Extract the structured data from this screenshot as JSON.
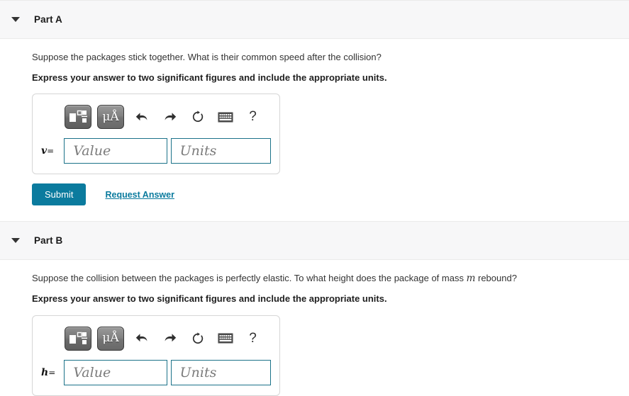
{
  "parts": [
    {
      "id": "part-a",
      "title": "Part A",
      "caret_icon": "chevron-down-icon",
      "question": "Suppose the packages stick together. What is their common speed after the collision?",
      "instruction": "Express your answer to two significant figures and include the appropriate units.",
      "variable": "v",
      "equals": "=",
      "value_placeholder": "Value",
      "units_placeholder": "Units",
      "value_text": "",
      "units_text": "",
      "toolbar": {
        "template_button": "template-icon",
        "units_button_label": "μÅ",
        "undo_icon": "undo-arrow-icon",
        "redo_icon": "redo-arrow-icon",
        "reset_icon": "reset-circular-arrow-icon",
        "keyboard_icon": "keyboard-icon",
        "help_icon": "?"
      },
      "submit_label": "Submit",
      "request_answer_label": "Request Answer",
      "has_actions": true
    },
    {
      "id": "part-b",
      "title": "Part B",
      "caret_icon": "chevron-down-icon",
      "question_prefix": "Suppose the collision between the packages is perfectly elastic. To what height does the package of mass ",
      "question_math": "m",
      "question_suffix": " rebound?",
      "instruction": "Express your answer to two significant figures and include the appropriate units.",
      "variable": "h",
      "equals": "=",
      "value_placeholder": "Value",
      "units_placeholder": "Units",
      "value_text": "",
      "units_text": "",
      "toolbar": {
        "template_button": "template-icon",
        "units_button_label": "μÅ",
        "undo_icon": "undo-arrow-icon",
        "redo_icon": "redo-arrow-icon",
        "reset_icon": "reset-circular-arrow-icon",
        "keyboard_icon": "keyboard-icon",
        "help_icon": "?"
      },
      "has_actions": false
    }
  ],
  "colors": {
    "accent": "#0b7b9e",
    "field_border": "#1b7289",
    "header_band": "#f7f7f8",
    "text": "#333333"
  }
}
